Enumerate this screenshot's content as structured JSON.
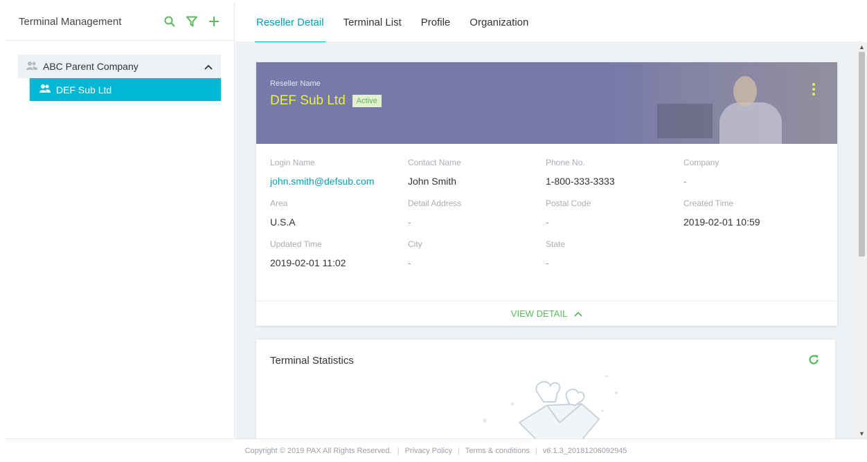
{
  "sidebar": {
    "title": "Terminal Management",
    "icons": [
      "search-icon",
      "filter-icon",
      "plus-icon"
    ],
    "tree": {
      "parent": {
        "label": "ABC Parent Company",
        "icon": "users-icon",
        "expanded": true
      },
      "children": [
        {
          "label": "DEF Sub Ltd",
          "icon": "users-icon",
          "selected": true
        }
      ]
    }
  },
  "tabs": [
    {
      "label": "Reseller Detail",
      "active": true
    },
    {
      "label": "Terminal List",
      "active": false
    },
    {
      "label": "Profile",
      "active": false
    },
    {
      "label": "Organization",
      "active": false
    }
  ],
  "reseller": {
    "name_label": "Reseller Name",
    "name": "DEF Sub Ltd",
    "status": "Active",
    "fields": [
      {
        "label": "Login Name",
        "value": "john.smith@defsub.com"
      },
      {
        "label": "Contact Name",
        "value": "John Smith"
      },
      {
        "label": "Phone No.",
        "value": "1-800-333-3333"
      },
      {
        "label": "Company",
        "value": "-"
      },
      {
        "label": "Area",
        "value": "U.S.A"
      },
      {
        "label": "Detail Address",
        "value": "-"
      },
      {
        "label": "Postal Code",
        "value": "-"
      },
      {
        "label": "Created Time",
        "value": "2019-02-01 10:59"
      },
      {
        "label": "Updated Time",
        "value": "2019-02-01 11:02"
      },
      {
        "label": "City",
        "value": "-"
      },
      {
        "label": "State",
        "value": "-"
      }
    ],
    "view_detail_label": "VIEW DETAIL"
  },
  "statistics": {
    "title": "Terminal Statistics",
    "refresh_icon": "refresh-icon"
  },
  "footer": {
    "copyright": "Copyright © 2019 PAX All Rights Reserved.",
    "privacy": "Privacy Policy",
    "terms": "Terms & conditions",
    "version": "v6.1.3_20181206092945"
  },
  "colors": {
    "accent": "#00b8d4",
    "green": "#5cb85c",
    "banner": "#7779a9",
    "name": "#e8f14a"
  }
}
